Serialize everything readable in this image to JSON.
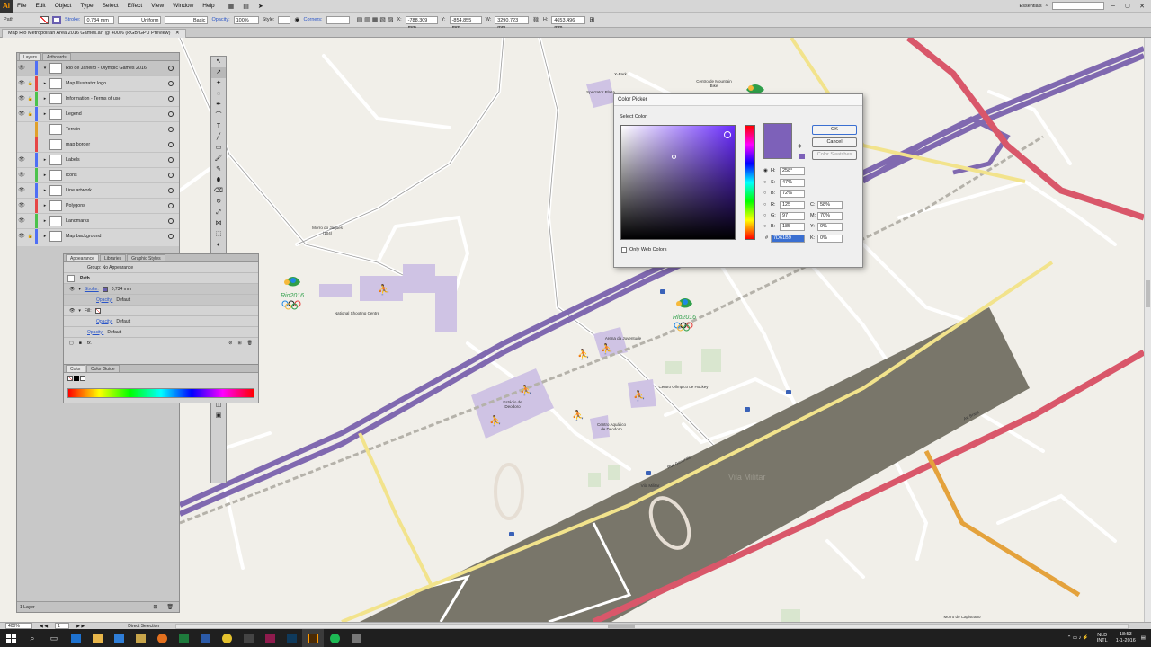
{
  "app": {
    "logo": "Ai",
    "menu": [
      "File",
      "Edit",
      "Object",
      "Type",
      "Select",
      "Effect",
      "View",
      "Window",
      "Help"
    ],
    "workspace": "Essentials",
    "search_placeholder": ""
  },
  "control_bar": {
    "selection_label": "Path",
    "stroke_label": "Stroke:",
    "stroke_value": "0,734 mm",
    "profile_value": "Uniform",
    "brush_value": "Basic",
    "opacity_label": "Opacity:",
    "opacity_value": "100%",
    "style_label": "Style:",
    "corners_label": "Corners:",
    "x_label": "X:",
    "x_value": "-788,309 mm",
    "y_label": "Y:",
    "y_value": "-854,855 mm",
    "w_label": "W:",
    "w_value": "3290,723 mm",
    "h_label": "H:",
    "h_value": "4653,496 mm"
  },
  "document_tab": "Map Rio Metropolitan Area 2016 Games.ai* @ 400% (RGB/GPU Preview)",
  "layers_panel": {
    "tabs": [
      "Layers",
      "Artboards"
    ],
    "layers": [
      {
        "name": "Rio de Janeiro - Olympic Games 2016",
        "color": "#4f6ff5",
        "locked": false,
        "top": true
      },
      {
        "name": "Map Illustrator logo",
        "color": "#e64646",
        "locked": true
      },
      {
        "name": "Information - Terms of use",
        "color": "#4cc24c",
        "locked": true
      },
      {
        "name": "Legend",
        "color": "#4f6ff5",
        "locked": true
      },
      {
        "name": "Terrain",
        "color": "#e0a02b",
        "locked": false
      },
      {
        "name": "map border",
        "color": "#e64646",
        "locked": false
      },
      {
        "name": "Labels",
        "color": "#4f6ff5",
        "locked": false
      },
      {
        "name": "Icons",
        "color": "#4cc24c",
        "locked": false
      },
      {
        "name": "Line artwork",
        "color": "#4f6ff5",
        "locked": false
      },
      {
        "name": "Polygons",
        "color": "#e64646",
        "locked": false
      },
      {
        "name": "Landmarks",
        "color": "#4cc24c",
        "locked": false
      },
      {
        "name": "Map background",
        "color": "#4f6ff5",
        "locked": true
      }
    ],
    "footer": "1 Layer"
  },
  "appearance_panel": {
    "tabs": [
      "Appearance",
      "Libraries",
      "Graphic Styles"
    ],
    "no_appearance": "Group: No Appearance",
    "path_label": "Path",
    "stroke_label": "Stroke:",
    "stroke_value": "0,734 mm",
    "opacity_label": "Opacity:",
    "opacity_value": "Default",
    "fill_label": "Fill:",
    "fill_opacity_label": "Opacity:",
    "fill_opacity_value": "Default",
    "path_opacity_label": "Opacity:",
    "path_opacity_value": "Default",
    "fx": "fx."
  },
  "color_panel": {
    "tabs": [
      "Color",
      "Color Guide"
    ]
  },
  "color_picker": {
    "title": "Color Picker",
    "select_color": "Select Color:",
    "ok": "OK",
    "cancel": "Cancel",
    "swatches": "Color Swatches",
    "only_web": "Only Web Colors",
    "h_label": "H:",
    "h_value": "258°",
    "s_label": "S:",
    "s_value": "47%",
    "b_label": "B:",
    "b_value": "72%",
    "r_label": "R:",
    "r_value": "125",
    "g_label": "G:",
    "g_value": "97",
    "bl_label": "B:",
    "bl_value": "185",
    "c_label": "C:",
    "c_value": "58%",
    "m_label": "M:",
    "m_value": "70%",
    "y_label": "Y:",
    "y_value": "0%",
    "k_label": "K:",
    "k_value": "0%",
    "hex_label": "#",
    "hex_value": "7D61B9",
    "color": "#7d61b9",
    "hue_color": "#6a2cff"
  },
  "map_labels": {
    "morro_jaques": "Morro do Jaques",
    "morro_jaques_sub": "(104)",
    "shooting": "National Shooting Centre",
    "arena_juventude": "Arena da Juventude",
    "hockey": "Centro Olímpico de Hockey",
    "deodoro_stadium": "Estádio de Deodoro",
    "aquatic": "Centro Aquático de Deodoro",
    "vila_militar_station": "Vila Militar",
    "vila_militar": "Vila Militar",
    "spectator_plaza": "Spectator Plaza",
    "x_park": "X-Park",
    "mountain_bike": "Centro de Mountain Bike",
    "morro_capistrano": "Morro do Capistrano",
    "rua_labels": [
      "Av. Brasil",
      "Rua Generais"
    ]
  },
  "status_bar": {
    "zoom": "400%",
    "artboard": "1",
    "tool": "Direct Selection"
  },
  "taskbar": {
    "lang": "NLD INTL",
    "time": "18:53",
    "date": "1-1-2016"
  }
}
